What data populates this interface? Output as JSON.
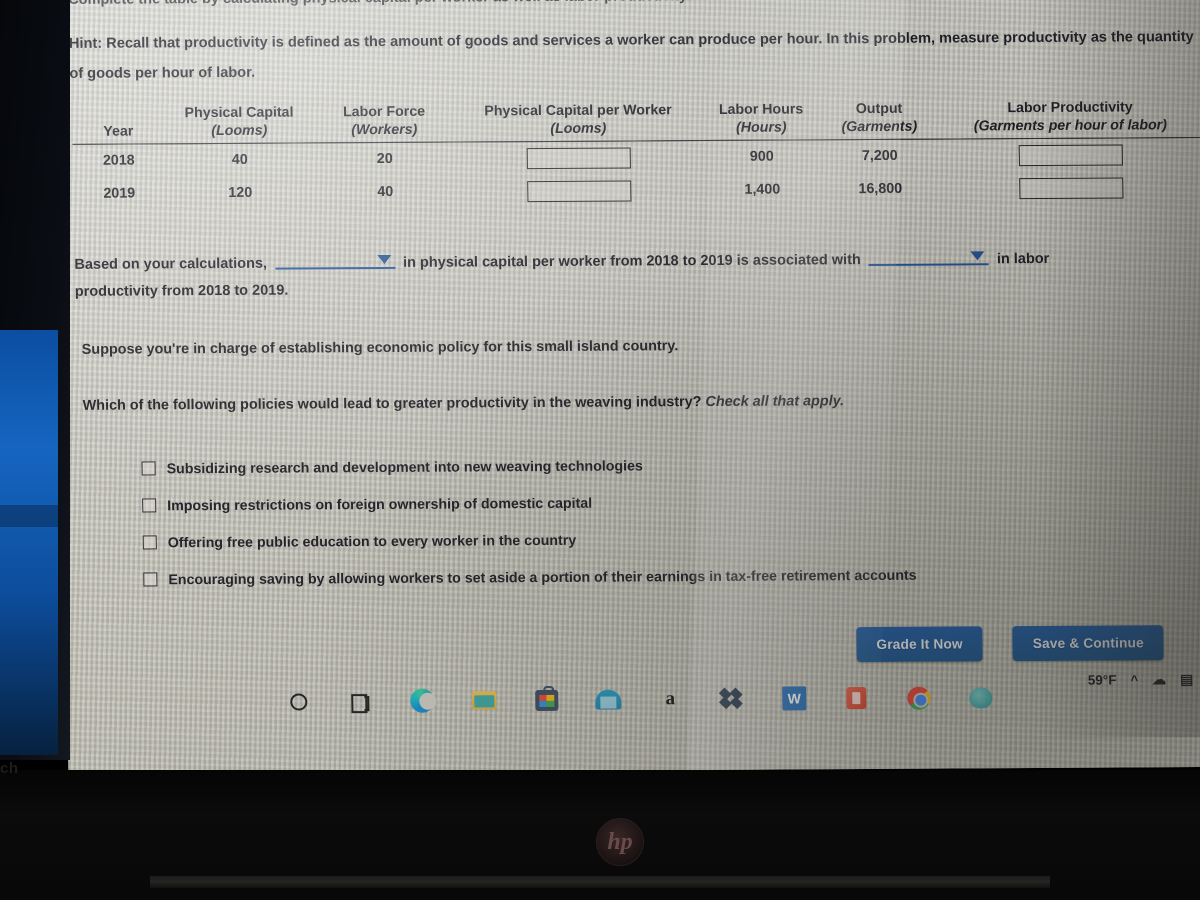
{
  "document": {
    "instruction_cut": "Complete the table by calculating physical capital per worker as well as labor productivity.",
    "hint_label": "Hint:",
    "hint_text": "Recall that productivity is defined as the amount of goods and services a worker can produce per hour. In this problem, measure productivity as the quantity of goods per hour of labor."
  },
  "table": {
    "headers_top": [
      "",
      "Physical Capital",
      "Labor Force",
      "Physical Capital per Worker",
      "Labor Hours",
      "Output",
      "Labor Productivity"
    ],
    "headers_units": [
      "Year",
      "(Looms)",
      "(Workers)",
      "(Looms)",
      "(Hours)",
      "(Garments)",
      "(Garments per hour of labor)"
    ],
    "rows": [
      {
        "year": "2018",
        "physical_capital": "40",
        "labor_force": "20",
        "physical_capital_per_worker": "",
        "labor_hours": "900",
        "output": "7,200",
        "labor_productivity": ""
      },
      {
        "year": "2019",
        "physical_capital": "120",
        "labor_force": "40",
        "physical_capital_per_worker": "",
        "labor_hours": "1,400",
        "output": "16,800",
        "labor_productivity": ""
      }
    ]
  },
  "conclusion": {
    "part1": "Based on your calculations,",
    "dropdown1_value": "",
    "part2": "in physical capital per worker from 2018 to 2019 is associated with",
    "dropdown2_value": "",
    "part3": "in labor",
    "part4": "productivity from 2018 to 2019."
  },
  "policy_question": {
    "intro": "Suppose you're in charge of establishing economic policy for this small island country.",
    "prompt": "Which of the following policies would lead to greater productivity in the weaving industry?",
    "prompt_italic": "Check all that apply.",
    "options": [
      {
        "label": "Subsidizing research and development into new weaving technologies",
        "checked": false
      },
      {
        "label": "Imposing restrictions on foreign ownership of domestic capital",
        "checked": false
      },
      {
        "label": "Offering free public education to every worker in the country",
        "checked": false
      },
      {
        "label": "Encouraging saving by allowing workers to set aside a portion of their earnings in tax-free retirement accounts",
        "checked": false
      }
    ]
  },
  "actions": {
    "grade_label": "Grade It Now",
    "save_label": "Save & Continue"
  },
  "taskbar": {
    "search_text_fragment": "ch",
    "icons": [
      "search-circle-icon",
      "task-view-icon",
      "microsoft-edge-icon",
      "file-explorer-icon",
      "microsoft-store-icon",
      "mail-icon",
      "letter-a-icon",
      "dropbox-icon",
      "word-icon",
      "office-icon",
      "chrome-icon",
      "teal-app-icon"
    ],
    "weather_temp": "59°F",
    "tray_icons": [
      "show-hidden-icons-chevron",
      "onedrive-cloud-icon",
      "network-icon",
      "battery-icon"
    ]
  },
  "hardware": {
    "laptop_brand": "hp"
  },
  "colors": {
    "accent_blue": "#1b4f96",
    "button_blue": "#16538f",
    "page_bg": "#cfcdc4",
    "text": "#15151e"
  }
}
